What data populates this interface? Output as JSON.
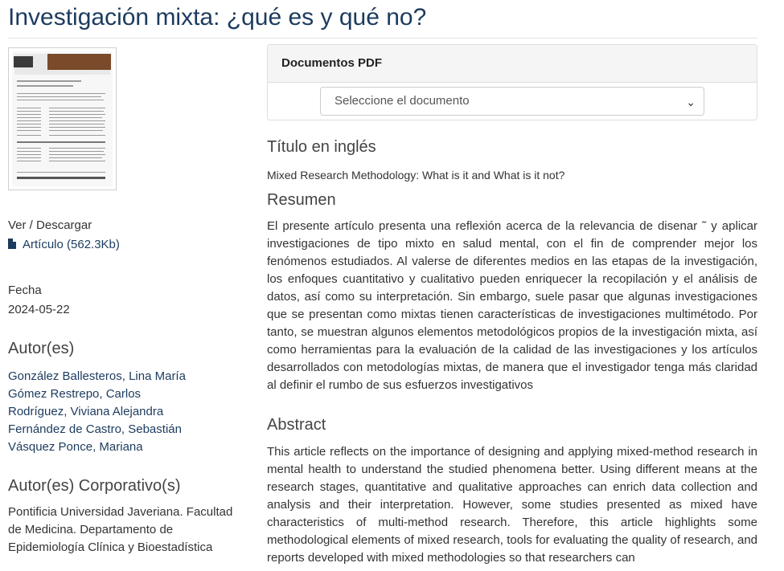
{
  "page_title": "Investigación mixta: ¿qué es y qué no?",
  "left": {
    "view_download_label": "Ver / Descargar",
    "file_link_label": "Artículo (562.3Kb)",
    "date_label": "Fecha",
    "date_value": "2024-05-22",
    "authors_heading": "Autor(es)",
    "authors": [
      "González Ballesteros, Lina María",
      "Gómez Restrepo, Carlos",
      "Rodríguez, Viviana Alejandra",
      "Fernández de Castro, Sebastián",
      "Vásquez Ponce, Mariana"
    ],
    "corporate_heading": "Autor(es) Corporativo(s)",
    "corporate": "Pontificia Universidad Javeriana. Facultad de Medicina. Departamento de Epidemiología Clínica y Bioestadística"
  },
  "pdf_panel": {
    "title": "Documentos PDF",
    "select_value": "Seleccione el documento"
  },
  "english_title_heading": "Título en inglés",
  "english_title": "Mixed Research Methodology: What is it and What is it not?",
  "resumen_heading": "Resumen",
  "resumen_text": "El presente artículo presenta una reflexión acerca de la relevancia de disenar ˜ y aplicar investigaciones de tipo mixto en salud mental, con el fin de comprender mejor los fenómenos estudiados. Al valerse de diferentes medios en las etapas de la investigación, los enfoques cuantitativo y cualitativo pueden enriquecer la recopilación y el análisis de datos, así como su interpretación. Sin embargo, suele pasar que algunas investigaciones que se presentan como mixtas tienen características de investigaciones multimétodo. Por tanto, se muestran algunos elementos metodológicos propios de la investigación mixta, así como herramientas para la evaluación de la calidad de las investigaciones y los artículos desarrollados con metodologías mixtas, de manera que el investigador tenga más claridad al definir el rumbo de sus esfuerzos investigativos",
  "abstract_heading": "Abstract",
  "abstract_text": "This article reflects on the importance of designing and applying mixed-method research in mental health to understand the studied phenomena better. Using different means at the research stages, quantitative and qualitative approaches can enrich data collection and analysis and their interpretation. However, some studies presented as mixed have characteristics of multi-method research. Therefore, this article highlights some methodological elements of mixed research, tools for evaluating the quality of research, and reports developed with mixed methodologies so that researchers can"
}
